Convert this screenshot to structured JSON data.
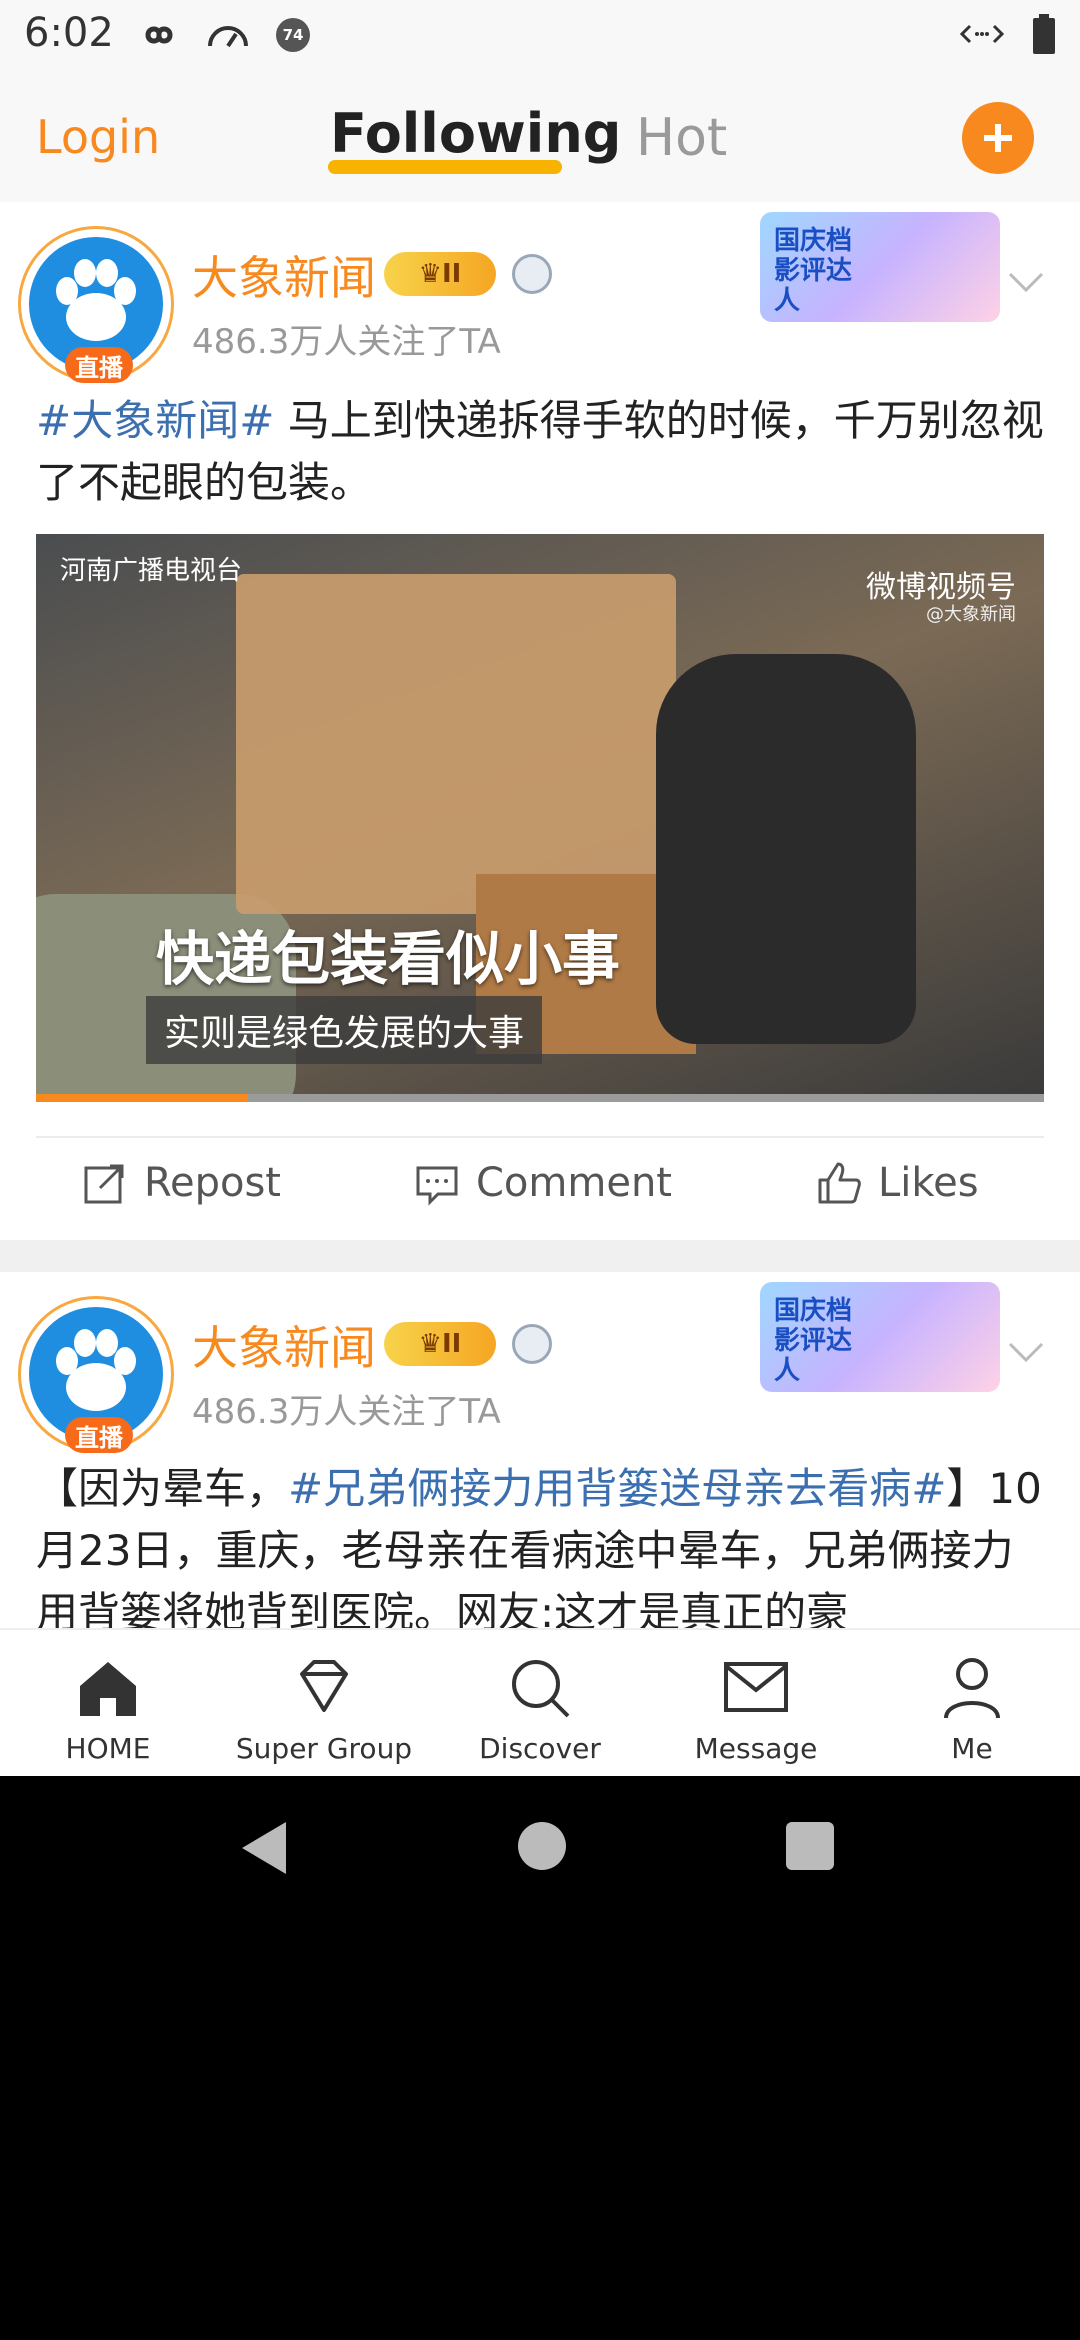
{
  "status": {
    "time": "6:02",
    "badge": "74"
  },
  "nav": {
    "login": "Login",
    "tabs": [
      "Following",
      "Hot"
    ],
    "active_tab": "Following"
  },
  "posts": [
    {
      "user": "大象新闻",
      "followers": "486.3万人关注了TA",
      "live_badge": "直播",
      "crown_level": "II",
      "promo": "国庆档影评达人",
      "topic": "#大象新闻#",
      "text": " 马上到快递拆得手软的时候，千万别忽视了不起眼的包装。",
      "media": {
        "source_logo": "河南广播电视台",
        "watermark": "微博视频号",
        "watermark_sub": "@大象新闻",
        "caption_main": "快递包装看似小事",
        "caption_sub": "实则是绿色发展的大事",
        "progress": 0.21
      },
      "actions": {
        "repost": "Repost",
        "comment": "Comment",
        "likes": "Likes"
      }
    },
    {
      "user": "大象新闻",
      "followers": "486.3万人关注了TA",
      "live_badge": "直播",
      "crown_level": "II",
      "promo": "国庆档影评达人",
      "text_prefix": "【因为晕车，",
      "topic": "#兄弟俩接力用背篓送母亲去看病#",
      "text_suffix": "】10月23日，重庆，老母亲在看病途中晕车，兄弟俩接力用背篓将她背到医院。网友:这才是真正的豪"
    }
  ],
  "tabbar": [
    "HOME",
    "Super Group",
    "Discover",
    "Message",
    "Me"
  ],
  "colors": {
    "accent": "#f7891f",
    "topic": "#3b6fb0",
    "tab_underline": "#f8b300"
  }
}
